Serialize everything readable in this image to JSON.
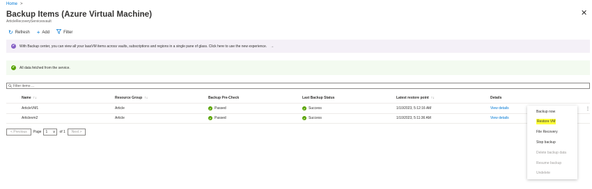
{
  "breadcrumb": {
    "home": "Home",
    "sep": ">"
  },
  "title": "Backup Items (Azure Virtual Machine)",
  "title_more": "···",
  "subtitle": "ArticleRecoveryServicesvault",
  "close_glyph": "✕",
  "toolbar": {
    "refresh": "Refresh",
    "add": "Add",
    "filter": "Filter"
  },
  "banner_info": "With Backup center, you can view all your IaasVM items across vaults, subscriptions and regions in a single pane of glass. Click here to use the new experience.",
  "banner_arrow": "→",
  "banner_success": "All data fetched from the service.",
  "filter_placeholder": "Filter items ...",
  "table": {
    "headers": {
      "name": "Name",
      "resource_group": "Resource Group",
      "precheck": "Backup Pre-Check",
      "last_status": "Last Backup Status",
      "restore_point": "Latest restore point",
      "details": "Details"
    },
    "sort_glyph": "↑↓",
    "rows": [
      {
        "name": "ArticleVM1",
        "resource_group": "Article",
        "precheck": "Passed",
        "last_status": "Success",
        "restore_point": "1/10/2023, 5:12:16 AM",
        "details": "View details"
      },
      {
        "name": "Articlevm2",
        "resource_group": "Article",
        "precheck": "Passed",
        "last_status": "Success",
        "restore_point": "1/10/2023, 5:11:36 AM",
        "details": "View details"
      }
    ]
  },
  "pager": {
    "previous": "< Previous",
    "page_label": "Page",
    "page_value": "1",
    "of_label": "of 1",
    "next": "Next >"
  },
  "context_menu": {
    "items": [
      {
        "label": "Backup now",
        "disabled": false
      },
      {
        "label": "Restore VM",
        "disabled": false,
        "highlight": true
      },
      {
        "label": "File Recovery",
        "disabled": false
      },
      {
        "label": "Stop backup",
        "disabled": false
      },
      {
        "label": "Delete backup data",
        "disabled": true
      },
      {
        "label": "Resume backup",
        "disabled": true
      },
      {
        "label": "Undelete",
        "disabled": true
      }
    ]
  },
  "colors": {
    "accent": "#0078d4",
    "success": "#57a300",
    "info_banner": "#f4f0f7",
    "success_banner": "#f3faf0",
    "highlight": "#ffff38"
  }
}
